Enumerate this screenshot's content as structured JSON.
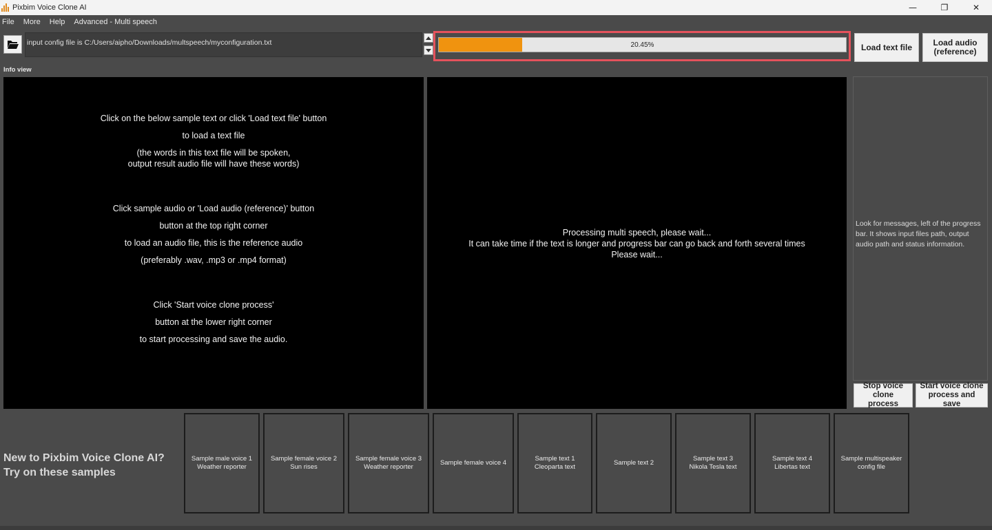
{
  "window": {
    "title": "Pixbim Voice Clone AI",
    "controls": [
      "—",
      "❐",
      "✕"
    ]
  },
  "menu": [
    "File",
    "More",
    "Help",
    "Advanced - Multi speech"
  ],
  "toolbar": {
    "path_text": "input config file is C:/Users/aipho/Downloads/multspeech/myconfiguration.txt",
    "progress_percent": 20.45,
    "progress_label": "20.45%",
    "load_text_label": "Load text file",
    "load_audio_label": "Load audio (reference)"
  },
  "info_view_label": "Info view",
  "left_panel": {
    "lines": [
      "Click on the below sample text or click 'Load text file' button",
      "to load a text file",
      "(the words in this text file will be spoken,",
      "output result audio file will have these words)",
      "Click sample audio or 'Load audio (reference)' button",
      "button at the top right corner",
      "to load an audio file, this is the reference audio",
      "(preferably .wav, .mp3 or .mp4 format)",
      "Click 'Start voice clone process'",
      "button at the lower right corner",
      "to start processing and save the audio."
    ]
  },
  "middle_panel": {
    "lines": [
      "Processing multi speech, please wait...",
      "It can take time if the text is longer and progress bar can go back and forth several times",
      "Please wait..."
    ]
  },
  "side_panel": {
    "message": "Look for messages, left of the progress bar. It shows input files path, output audio path and status information."
  },
  "actions": {
    "stop_label": "Stop voice clone process",
    "start_label": "Start voice clone process and save"
  },
  "samples": {
    "heading_line1": "New to Pixbim Voice Clone AI?",
    "heading_line2": "Try on these samples",
    "cards": [
      {
        "line1": "Sample male voice 1",
        "line2": "Weather reporter"
      },
      {
        "line1": "Sample female voice 2",
        "line2": "Sun rises"
      },
      {
        "line1": "Sample female voice 3",
        "line2": "Weather reporter"
      },
      {
        "line1": "Sample female voice 4",
        "line2": ""
      },
      {
        "line1": "Sample text 1",
        "line2": "Cleoparta text"
      },
      {
        "line1": "Sample text 2",
        "line2": ""
      },
      {
        "line1": "Sample text 3",
        "line2": "Nikola Tesla text"
      },
      {
        "line1": "Sample text 4",
        "line2": "Libertas text"
      },
      {
        "line1": "Sample multispeaker",
        "line2": "config file"
      }
    ]
  },
  "colors": {
    "progress_fill": "#f0930f",
    "highlight_border": "#e5525c",
    "panel_bg": "#000000",
    "app_bg": "#4a4a4a"
  }
}
